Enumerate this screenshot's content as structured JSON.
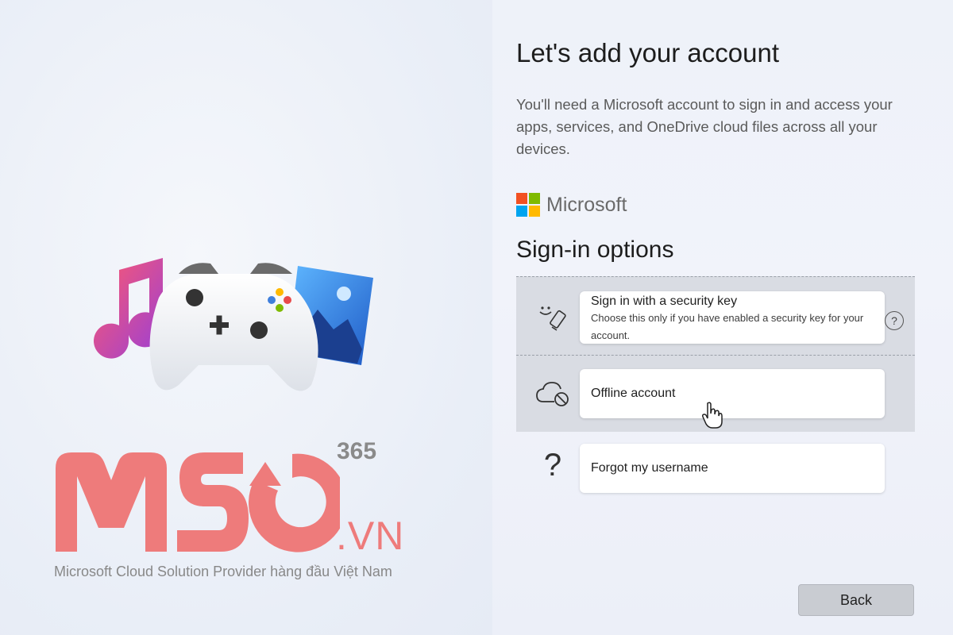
{
  "page": {
    "heading": "Let's add your account",
    "description": "You'll need a Microsoft account to sign in and access your apps, services, and OneDrive cloud files across all your devices.",
    "brand": "Microsoft",
    "section_title": "Sign-in options"
  },
  "options": [
    {
      "title": "Sign in with a security key",
      "subtitle": "Choose this only if you have enabled a security key for your account.",
      "icon": "security-key-icon",
      "help_label": "?"
    },
    {
      "title": "Offline account",
      "icon": "offline-cloud-icon"
    },
    {
      "title": "Forgot my username",
      "icon": "question-mark-icon"
    }
  ],
  "footer": {
    "back_label": "Back"
  },
  "watermark": {
    "superscript": "365",
    "domain": ".VN",
    "tagline": "Microsoft Cloud Solution Provider hàng đầu Việt Nam"
  },
  "colors": {
    "ms_red": "#f25022",
    "ms_green": "#7fba00",
    "ms_blue": "#00a4ef",
    "ms_yellow": "#ffb900",
    "logo_pink": "#ee7b7b",
    "shaded_row": "#d9dce3"
  }
}
